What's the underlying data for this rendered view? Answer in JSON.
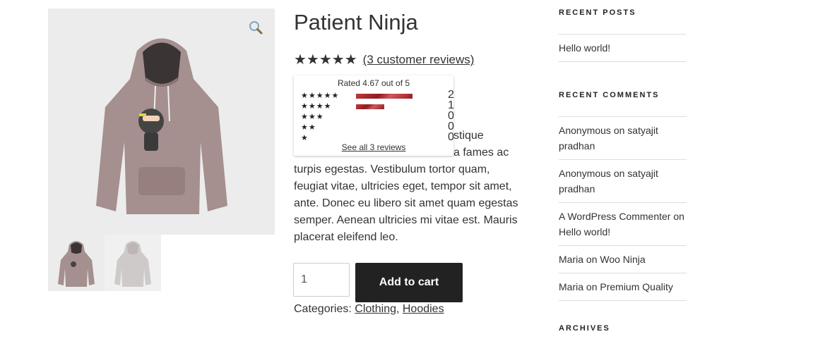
{
  "product": {
    "title": "Patient Ninja",
    "stars": "★★★★★",
    "reviews_link": "(3 customer reviews)",
    "description": "Pellentesque habitant morbi tristique senectus et netus et malesuada fames ac turpis egestas. Vestibulum tortor quam, feugiat vitae, ultricies eget, tempor sit amet, ante. Donec eu libero sit amet quam egestas semper. Aenean ultricies mi vitae est. Mauris placerat eleifend leo.",
    "desc_visible": {
      "line1": "stique",
      "line2": "a fames ac",
      "rest": "turpis egestas. Vestibulum tortor quam, feugiat vitae, ultricies eget, tempor sit amet, ante. Donec eu libero sit amet quam egestas semper. Aenean ultricies mi vitae est. Mauris placerat eleifend leo."
    },
    "quantity": "1",
    "add_to_cart": "Add to cart",
    "categories_label": "Categories:",
    "category_1": "Clothing",
    "category_sep": ", ",
    "category_2": "Hoodies"
  },
  "rating_popup": {
    "title": "Rated 4.67 out of 5",
    "rows": [
      {
        "stars": "★★★★★",
        "fraction": 1.0,
        "count": "2"
      },
      {
        "stars": "★★★★",
        "fraction": 0.5,
        "count": "1"
      },
      {
        "stars": "★★★",
        "fraction": 0,
        "count": "0"
      },
      {
        "stars": "★★",
        "fraction": 0,
        "count": "0"
      },
      {
        "stars": "★",
        "fraction": 0,
        "count": "0"
      }
    ],
    "see_all": "See all 3 reviews"
  },
  "gallery": {
    "zoom_icon": "magnifier-icon",
    "hoodie_color": "#a58f8f",
    "thumb2_color": "#cfcaca"
  },
  "sidebar": {
    "recent_posts_title": "RECENT POSTS",
    "recent_posts": [
      "Hello world!"
    ],
    "recent_comments_title": "RECENT COMMENTS",
    "recent_comments": [
      {
        "author": "Anonymous",
        "on": " on ",
        "post": "satyajit pradhan"
      },
      {
        "author": "Anonymous",
        "on": " on ",
        "post": "satyajit pradhan"
      },
      {
        "author": "A WordPress Commenter",
        "on": " on ",
        "post": "Hello world!"
      },
      {
        "author": "Maria",
        "on": " on ",
        "post": "Woo Ninja"
      },
      {
        "author": "Maria",
        "on": " on ",
        "post": "Premium Quality"
      }
    ],
    "archives_title": "ARCHIVES"
  },
  "colors": {
    "button_bg": "#222222",
    "bar_red": "#a8292e",
    "text": "#333333"
  }
}
